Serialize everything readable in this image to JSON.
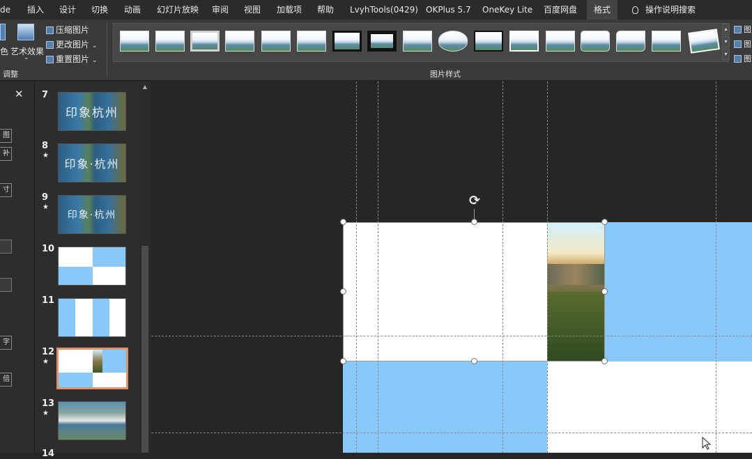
{
  "ribbon_tabs": [
    "de",
    "插入",
    "设计",
    "切换",
    "动画",
    "幻灯片放映",
    "审阅",
    "视图",
    "加载项",
    "帮助",
    "LvyhTools(0429)",
    "OKPlus 5.7",
    "OneKey Lite",
    "百度网盘",
    "格式"
  ],
  "active_tab": "格式",
  "tell_me": "操作说明搜索",
  "adjust": {
    "color_fragment": "色",
    "artistic_effects": "艺术效果",
    "compress_pictures": "压缩图片",
    "change_picture": "更改图片",
    "reset_picture": "重置图片",
    "group_label": "调整"
  },
  "picture_styles": {
    "group_label": "图片样式",
    "right_fragment": "图"
  },
  "left_pane": {
    "close": "✕",
    "btn_fragments": [
      "图",
      "补",
      "寸",
      "字",
      "倍"
    ]
  },
  "slides": [
    {
      "num": "7",
      "star": "",
      "type": "hangzhou_circles",
      "text": "印象杭州"
    },
    {
      "num": "8",
      "star": "★",
      "type": "hangzhou",
      "text": "印象·杭州"
    },
    {
      "num": "9",
      "star": "★",
      "type": "hangzhou",
      "text": "印象·杭州"
    },
    {
      "num": "10",
      "star": "",
      "type": "grid4"
    },
    {
      "num": "11",
      "star": "",
      "type": "stripes"
    },
    {
      "num": "12",
      "star": "★",
      "type": "grid_photo",
      "selected": true
    },
    {
      "num": "13",
      "star": "★",
      "type": "collage"
    }
  ],
  "colors": {
    "accent_blue": "#88c8fb",
    "selection_border": "#e0906a",
    "ribbon_bg": "#3a3a3a",
    "canvas_bg": "#262626"
  },
  "icons": {
    "rotate": "rotate-handle-icon",
    "cursor": "mouse-pointer-icon",
    "lightbulb": "lightbulb-icon"
  }
}
